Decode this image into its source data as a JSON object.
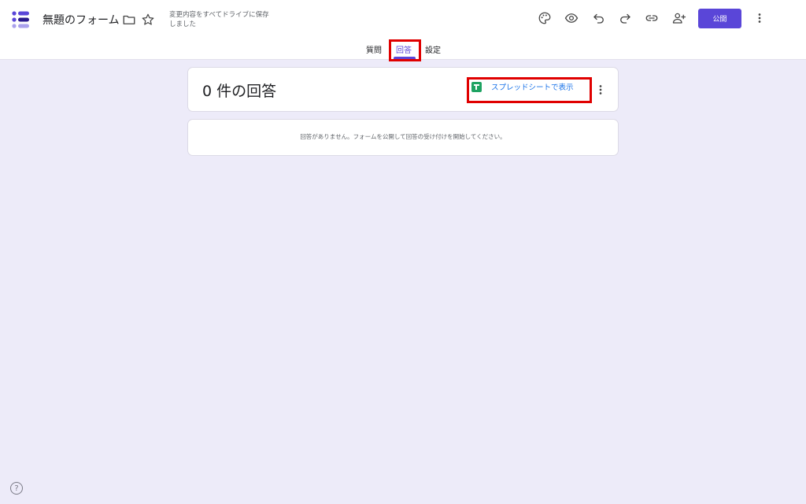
{
  "header": {
    "form_title": "無題のフォーム",
    "save_status": "変更内容をすべてドライブに保存しました",
    "publish_label": "公開"
  },
  "tabs": [
    {
      "label": "質問",
      "active": false
    },
    {
      "label": "回答",
      "active": true
    },
    {
      "label": "設定",
      "active": false
    }
  ],
  "responses": {
    "count_title": "0 件の回答",
    "sheets_link_label": "スプレッドシートで表示",
    "empty_message": "回答がありません。フォームを公開して回答の受け付けを開始してください。"
  },
  "help_label": "?",
  "colors": {
    "accent": "#5a46d8",
    "background": "#edebf9",
    "sheets_green": "#1ea362",
    "link_blue": "#1a73e8",
    "highlight_red": "#e00000"
  },
  "icons": [
    "forms-logo-icon",
    "folder-icon",
    "star-icon",
    "palette-icon",
    "preview-eye-icon",
    "undo-icon",
    "redo-icon",
    "link-icon",
    "add-collaborator-icon",
    "more-vert-icon",
    "sheets-icon",
    "help-icon"
  ]
}
